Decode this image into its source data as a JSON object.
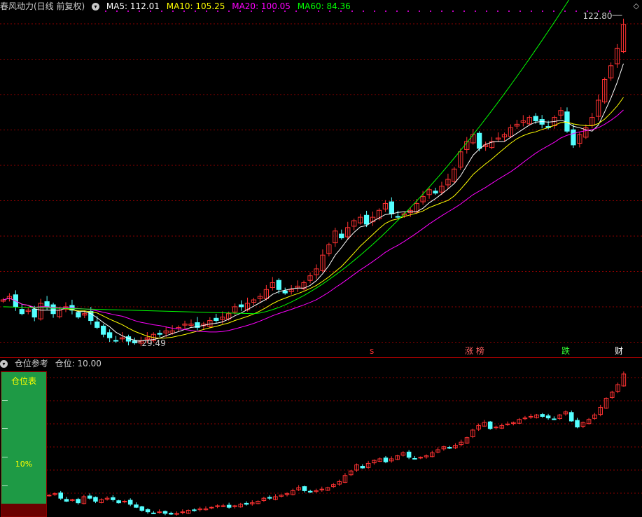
{
  "main_header": {
    "title": "春风动力(日线 前复权)",
    "ma5_label": "MA5: 112.01",
    "ma10_label": "MA10: 105.25",
    "ma20_label": "MA20: 100.05",
    "ma60_label": "MA60: 84.36"
  },
  "colors": {
    "up": "#ff3232",
    "down": "#54ffff",
    "ma5": "#ffffff",
    "ma10": "#ffff00",
    "ma20": "#ff00ff",
    "ma60": "#00ff00",
    "grid": "#8b0000"
  },
  "price_labels": {
    "high": "122.80",
    "low": "29.49"
  },
  "markers": [
    {
      "name": "s-marker",
      "text": "s",
      "color": "#ff3232"
    },
    {
      "name": "zhangbang-marker",
      "text": "涨 榜",
      "color": "#ff6060"
    },
    {
      "name": "die-marker",
      "text": "跌",
      "color": "#33ff33"
    },
    {
      "name": "cai-marker",
      "text": "财",
      "color": "#ffffff"
    }
  ],
  "sub_header": {
    "title": "仓位参考",
    "position_label": "仓位: 10.00"
  },
  "position_panel": {
    "title": "仓位表",
    "percent": "10%"
  },
  "chart_data": {
    "type": "candlestick",
    "title": "春风动力(日线 前复权)",
    "high": 122.8,
    "low": 29.49,
    "closes": [
      42,
      43,
      40,
      38,
      39,
      37,
      41,
      40,
      38,
      39,
      40,
      39,
      37,
      38,
      36,
      34,
      32,
      31,
      30,
      31,
      30,
      29.5,
      30,
      31,
      32,
      32,
      33,
      33,
      34,
      35,
      35,
      34,
      35,
      36,
      36,
      37,
      38,
      40,
      40,
      41,
      42,
      43,
      45,
      47,
      45,
      44,
      45,
      46,
      47,
      49,
      51,
      55,
      58,
      62,
      60,
      63,
      65,
      66,
      64,
      66,
      68,
      70,
      67,
      66,
      67,
      68,
      70,
      72,
      74,
      73,
      75,
      77,
      80,
      85,
      88,
      90,
      86,
      87,
      88,
      89,
      90,
      92,
      93,
      94,
      95,
      94,
      93,
      92,
      95,
      97,
      91,
      87,
      90,
      92,
      95,
      100,
      106,
      110,
      115,
      122
    ]
  }
}
